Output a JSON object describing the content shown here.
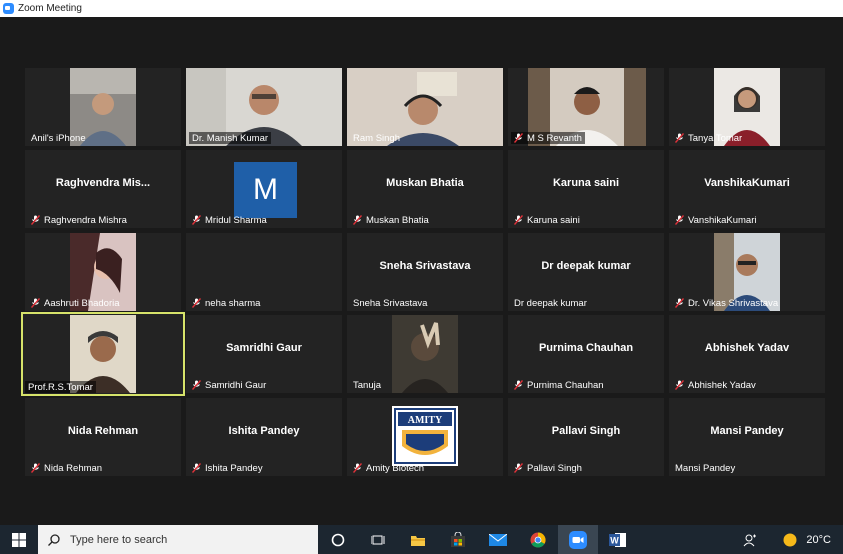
{
  "window": {
    "title": "Zoom Meeting"
  },
  "participants": [
    {
      "name": "Anil's iPhone",
      "display": "",
      "muted": false,
      "video": true
    },
    {
      "name": "Dr. Manish Kumar",
      "display": "",
      "muted": false,
      "video": true
    },
    {
      "name": "Ram Singh",
      "display": "",
      "muted": false,
      "video": true
    },
    {
      "name": "M S Revanth",
      "display": "",
      "muted": true,
      "video": true
    },
    {
      "name": "Tanya Tomar",
      "display": "",
      "muted": true,
      "video": true
    },
    {
      "name": "Raghvendra Mishra",
      "display": "Raghvendra  Mis...",
      "muted": true,
      "video": false
    },
    {
      "name": "Mridul Sharma",
      "display": "",
      "muted": true,
      "video": false,
      "avatar_letter": "M"
    },
    {
      "name": "Muskan Bhatia",
      "display": "Muskan Bhatia",
      "muted": true,
      "video": false
    },
    {
      "name": "Karuna saini",
      "display": "Karuna saini",
      "muted": true,
      "video": false
    },
    {
      "name": "VanshikaKumari",
      "display": "VanshikaKumari",
      "muted": true,
      "video": false
    },
    {
      "name": "Aashruti Bhadoria",
      "display": "",
      "muted": true,
      "video": true
    },
    {
      "name": "neha sharma",
      "display": "",
      "muted": true,
      "video": false
    },
    {
      "name": "Sneha Srivastava",
      "display": "Sneha Srivastava",
      "muted": false,
      "video": false
    },
    {
      "name": "Dr deepak kumar",
      "display": "Dr deepak kumar",
      "muted": false,
      "video": false
    },
    {
      "name": "Dr. Vikas Shrivastava",
      "display": "",
      "muted": true,
      "video": true
    },
    {
      "name": "Prof.R.S.Tomar",
      "display": "",
      "muted": false,
      "video": true,
      "active_speaker": true
    },
    {
      "name": "Samridhi Gaur",
      "display": "Samridhi Gaur",
      "muted": true,
      "video": false
    },
    {
      "name": "Tanuja",
      "display": "",
      "muted": false,
      "video": true
    },
    {
      "name": "Purnima Chauhan",
      "display": "Purnima Chauhan",
      "muted": true,
      "video": false
    },
    {
      "name": "Abhishek Yadav",
      "display": "Abhishek Yadav",
      "muted": true,
      "video": false
    },
    {
      "name": "Nida Rehman",
      "display": "Nida Rehman",
      "muted": true,
      "video": false
    },
    {
      "name": "Ishita Pandey",
      "display": "Ishita Pandey",
      "muted": true,
      "video": false
    },
    {
      "name": "Amity Biotech",
      "display": "",
      "muted": true,
      "video": true,
      "logo_text": "AMITY"
    },
    {
      "name": "Pallavi Singh",
      "display": "Pallavi Singh",
      "muted": true,
      "video": false
    },
    {
      "name": "Mansi Pandey",
      "display": "Mansi Pandey",
      "muted": false,
      "video": false
    }
  ],
  "taskbar": {
    "search_placeholder": "Type here to search",
    "temperature": "20°C",
    "apps": [
      "cortana-icon",
      "task-view-icon",
      "file-explorer-icon",
      "store-icon",
      "mail-icon",
      "chrome-icon",
      "zoom-icon",
      "word-icon"
    ]
  },
  "colors": {
    "active_speaker_border": "#d6e36a",
    "muted_icon": "#e0323a",
    "zoom_blue": "#2d8cff"
  }
}
